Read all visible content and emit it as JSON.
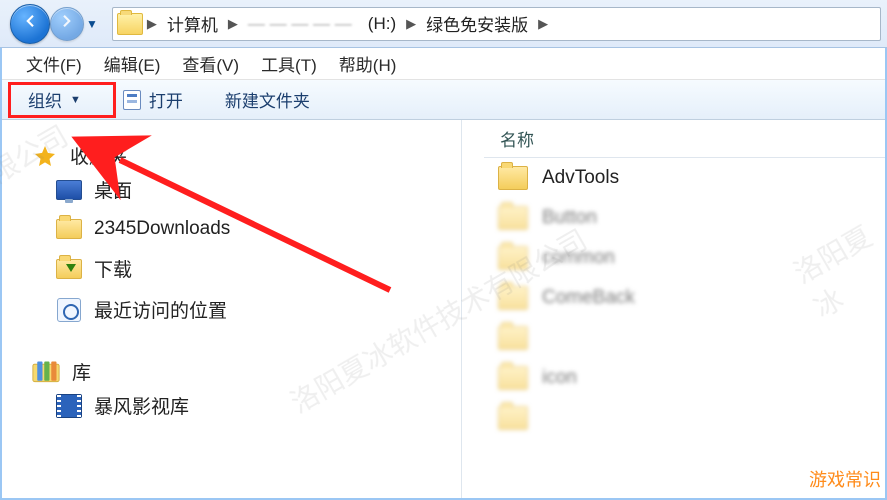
{
  "breadcrumb": {
    "items": [
      {
        "label": "计算机",
        "obscured": false
      },
      {
        "label": "— — — — —",
        "obscured": true
      },
      {
        "label": "(H:)",
        "obscured": false
      },
      {
        "label": "绿色免安装版",
        "obscured": false
      }
    ]
  },
  "menubar": [
    {
      "key": "file",
      "label": "文件(F)"
    },
    {
      "key": "edit",
      "label": "编辑(E)"
    },
    {
      "key": "view",
      "label": "查看(V)"
    },
    {
      "key": "tools",
      "label": "工具(T)"
    },
    {
      "key": "help",
      "label": "帮助(H)"
    }
  ],
  "cmdbar": {
    "organize": "组织",
    "open": "打开",
    "new_folder": "新建文件夹"
  },
  "navpane": {
    "favorites_label": "收藏夹",
    "favorites": [
      {
        "key": "desktop",
        "label": "桌面",
        "icon": "monitor"
      },
      {
        "key": "downloads",
        "label": "2345Downloads",
        "icon": "folder"
      },
      {
        "key": "dl",
        "label": "下载",
        "icon": "folder-dl"
      },
      {
        "key": "recent",
        "label": "最近访问的位置",
        "icon": "recent"
      }
    ],
    "libraries_label": "库",
    "libraries": [
      {
        "key": "storm",
        "label": "暴风影视库",
        "icon": "film"
      }
    ]
  },
  "content": {
    "column_header": "名称",
    "items": [
      {
        "label": "AdvTools",
        "blurred": false
      },
      {
        "label": "Button",
        "blurred": true
      },
      {
        "label": "common",
        "blurred": true
      },
      {
        "label": "ComeBack",
        "blurred": true
      },
      {
        "label": " ",
        "blurred": true
      },
      {
        "label": "icon",
        "blurred": true
      },
      {
        "label": " ",
        "blurred": true
      }
    ]
  },
  "watermarks": {
    "corner": "游戏常识",
    "diag1": "洛阳夏冰软件技术有限公司",
    "diag2": "洛阳夏冰"
  }
}
